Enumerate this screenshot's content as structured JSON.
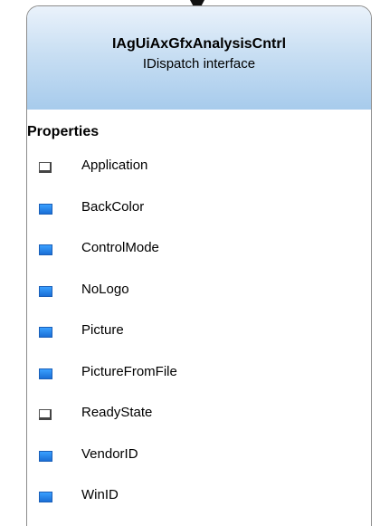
{
  "header": {
    "title": "IAgUiAxGfxAnalysisCntrl",
    "subtitle": "IDispatch interface"
  },
  "section": {
    "label": "Properties"
  },
  "colors": {
    "header_top": "#eaf2fb",
    "header_bottom": "#a7cbec",
    "property_icon": "#1a6fd6"
  },
  "properties": [
    {
      "name": "Application",
      "icon": "empty-square-icon"
    },
    {
      "name": "BackColor",
      "icon": "blue-square-icon"
    },
    {
      "name": "ControlMode",
      "icon": "blue-square-icon"
    },
    {
      "name": "NoLogo",
      "icon": "blue-square-icon"
    },
    {
      "name": "Picture",
      "icon": "blue-square-icon"
    },
    {
      "name": "PictureFromFile",
      "icon": "blue-square-icon"
    },
    {
      "name": "ReadyState",
      "icon": "empty-square-icon"
    },
    {
      "name": "VendorID",
      "icon": "blue-square-icon"
    },
    {
      "name": "WinID",
      "icon": "blue-square-icon"
    }
  ]
}
